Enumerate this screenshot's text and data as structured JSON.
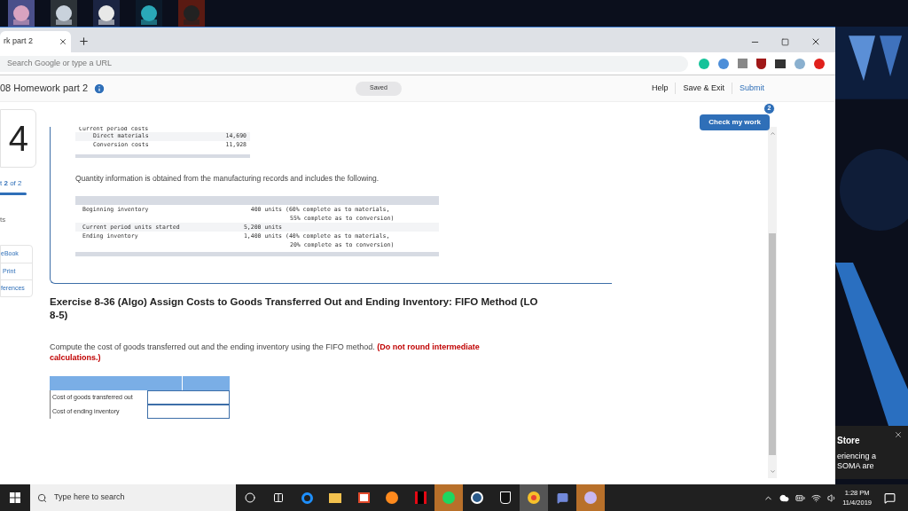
{
  "browser": {
    "tabs": [
      {
        "label": "rk part 2",
        "selected": true
      }
    ],
    "address_bar": {
      "placeholder": "Search Google or type a URL"
    }
  },
  "header": {
    "title": "08 Homework part 2",
    "status": "Saved",
    "links": [
      "Help",
      "Save & Exit",
      "Submit"
    ]
  },
  "sidebar": {
    "question_number": "4",
    "progress_text": "t **2** of 2",
    "progress": {
      "level": 1
    },
    "label": "ts",
    "links": [
      "eBook",
      "Print",
      "ferences"
    ]
  },
  "check_button": {
    "label": "Check my work",
    "badge": "2"
  },
  "cost_table": {
    "heading": "Current period costs",
    "rows": [
      {
        "label": "Direct materials",
        "value": "14,690"
      },
      {
        "label": "Conversion costs",
        "value": "11,928"
      }
    ]
  },
  "quantity_intro": "Quantity information is obtained from the manufacturing records and includes the following.",
  "quantity_table": [
    {
      "label": "Beginning inventory",
      "amount": "400 units",
      "note": [
        "(60% complete as to materials,",
        "55% complete as to conversion)"
      ]
    },
    {
      "label": "Current period units started",
      "amount": "5,200 units"
    },
    {
      "label": "Ending inventory",
      "amount": "1,400 units",
      "note": [
        "(40% complete as to materials,",
        "20% complete as to conversion)"
      ]
    }
  ],
  "exercise_title": "Exercise 8-36 (Algo) Assign Costs to Goods Transferred Out and Ending Inventory: FIFO Method (LO 8-5)",
  "instruction": "Compute the cost of goods transferred out and the ending inventory using the FIFO method. **(Do not round intermediate calculations.)**",
  "answer_rows": [
    {
      "label": "Cost of goods transferred out"
    },
    {
      "label": "Cost of ending inventory"
    }
  ],
  "toast": {
    "title": "Store",
    "lines": [
      "eriencing a",
      "SOMA are"
    ]
  },
  "taskbar": {
    "search_placeholder": "Type here to search",
    "time": "1:28 PM",
    "date": "11/4/2019"
  }
}
